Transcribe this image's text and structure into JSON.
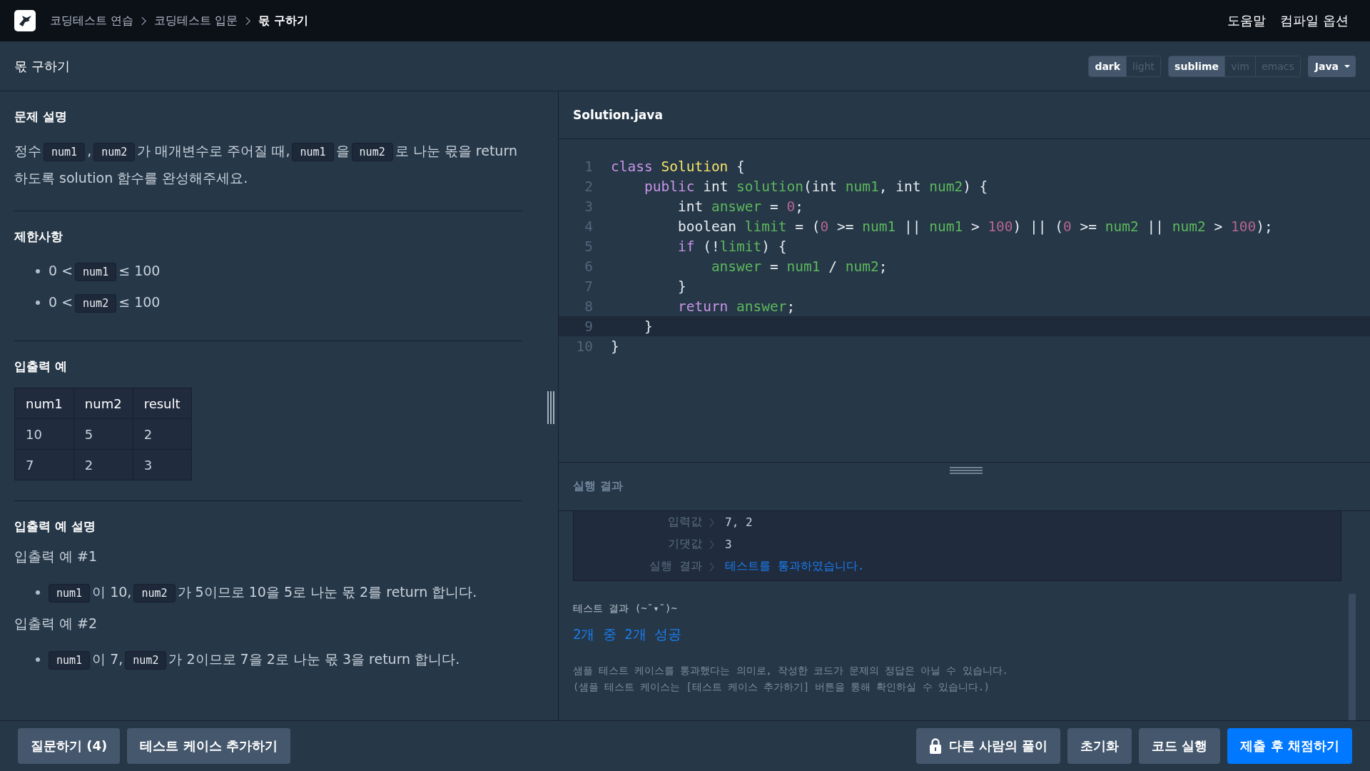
{
  "nav": {
    "breadcrumbs": [
      {
        "label": "코딩테스트 연습",
        "current": false
      },
      {
        "label": "코딩테스트 입문",
        "current": false
      },
      {
        "label": "몫 구하기",
        "current": true
      }
    ],
    "links": [
      "도움말",
      "컴파일 옵션"
    ]
  },
  "title_bar": {
    "title": "몫 구하기",
    "theme_options": [
      {
        "label": "dark",
        "selected": true
      },
      {
        "label": "light",
        "selected": false
      }
    ],
    "keymap_options": [
      {
        "label": "sublime",
        "selected": true
      },
      {
        "label": "vim",
        "selected": false
      },
      {
        "label": "emacs",
        "selected": false
      }
    ],
    "language": "Java"
  },
  "problem": {
    "sections": [
      {
        "kind": "paragraph",
        "heading": "문제 설명",
        "segments": [
          {
            "kind": "text",
            "text": "정수"
          },
          {
            "kind": "code",
            "text": "num1"
          },
          {
            "kind": "text",
            "text": ","
          },
          {
            "kind": "code",
            "text": "num2"
          },
          {
            "kind": "text",
            "text": "가 매개변수로 주어질 때,"
          },
          {
            "kind": "code",
            "text": "num1"
          },
          {
            "kind": "text",
            "text": "을"
          },
          {
            "kind": "code",
            "text": "num2"
          },
          {
            "kind": "text",
            "text": "로 나눈 몫을 return 하도록 solution 함수를 완성해주세요."
          }
        ]
      },
      {
        "kind": "bullets",
        "heading": "제한사항",
        "items": [
          {
            "segments": [
              {
                "kind": "text",
                "text": "0 <"
              },
              {
                "kind": "code",
                "text": "num1"
              },
              {
                "kind": "text",
                "text": "≤ 100"
              }
            ]
          },
          {
            "segments": [
              {
                "kind": "text",
                "text": "0 <"
              },
              {
                "kind": "code",
                "text": "num2"
              },
              {
                "kind": "text",
                "text": "≤ 100"
              }
            ]
          }
        ]
      },
      {
        "kind": "table",
        "heading": "입출력 예",
        "columns": [
          "num1",
          "num2",
          "result"
        ],
        "rows": [
          [
            "10",
            "5",
            "2"
          ],
          [
            "7",
            "2",
            "3"
          ]
        ]
      },
      {
        "kind": "examples",
        "heading": "입출력 예 설명",
        "examples": [
          {
            "title": "입출력 예 #1",
            "items": [
              {
                "segments": [
                  {
                    "kind": "code",
                    "text": "num1"
                  },
                  {
                    "kind": "text",
                    "text": "이 10,"
                  },
                  {
                    "kind": "code",
                    "text": "num2"
                  },
                  {
                    "kind": "text",
                    "text": "가 5이므로 10을 5로 나눈 몫 2를 return 합니다."
                  }
                ]
              }
            ]
          },
          {
            "title": "입출력 예 #2",
            "items": [
              {
                "segments": [
                  {
                    "kind": "code",
                    "text": "num1"
                  },
                  {
                    "kind": "text",
                    "text": "이 7,"
                  },
                  {
                    "kind": "code",
                    "text": "num2"
                  },
                  {
                    "kind": "text",
                    "text": "가 2이므로 7을 2로 나눈 몫 3을 return 합니다."
                  }
                ]
              }
            ]
          }
        ]
      }
    ]
  },
  "editor": {
    "filename": "Solution.java",
    "lines": [
      {
        "number": "1",
        "active": false,
        "tokens": [
          {
            "kind": "keyword",
            "text": "class"
          },
          {
            "kind": "class",
            "text": " Solution"
          },
          {
            "kind": "plain",
            "text": " {"
          }
        ]
      },
      {
        "number": "2",
        "active": false,
        "tokens": [
          {
            "kind": "keyword",
            "text": "    public"
          },
          {
            "kind": "plain",
            "text": " int "
          },
          {
            "kind": "name",
            "text": "solution"
          },
          {
            "kind": "plain",
            "text": "(int "
          },
          {
            "kind": "name",
            "text": "num1"
          },
          {
            "kind": "plain",
            "text": ", int "
          },
          {
            "kind": "name",
            "text": "num2"
          },
          {
            "kind": "plain",
            "text": ") {"
          }
        ]
      },
      {
        "number": "3",
        "active": false,
        "tokens": [
          {
            "kind": "plain",
            "text": "        int "
          },
          {
            "kind": "name",
            "text": "answer"
          },
          {
            "kind": "plain",
            "text": " = "
          },
          {
            "kind": "number",
            "text": "0"
          },
          {
            "kind": "plain",
            "text": ";"
          }
        ]
      },
      {
        "number": "4",
        "active": false,
        "tokens": [
          {
            "kind": "plain",
            "text": "        boolean "
          },
          {
            "kind": "name",
            "text": "limit"
          },
          {
            "kind": "plain",
            "text": " = ("
          },
          {
            "kind": "number",
            "text": "0"
          },
          {
            "kind": "plain",
            "text": " >= "
          },
          {
            "kind": "name",
            "text": "num1"
          },
          {
            "kind": "plain",
            "text": " || "
          },
          {
            "kind": "name",
            "text": "num1"
          },
          {
            "kind": "plain",
            "text": " > "
          },
          {
            "kind": "number",
            "text": "100"
          },
          {
            "kind": "plain",
            "text": ") || ("
          },
          {
            "kind": "number",
            "text": "0"
          },
          {
            "kind": "plain",
            "text": " >= "
          },
          {
            "kind": "name",
            "text": "num2"
          },
          {
            "kind": "plain",
            "text": " || "
          },
          {
            "kind": "name",
            "text": "num2"
          },
          {
            "kind": "plain",
            "text": " > "
          },
          {
            "kind": "number",
            "text": "100"
          },
          {
            "kind": "plain",
            "text": ");"
          }
        ]
      },
      {
        "number": "5",
        "active": false,
        "tokens": [
          {
            "kind": "keyword",
            "text": "        if"
          },
          {
            "kind": "plain",
            "text": " (!"
          },
          {
            "kind": "name",
            "text": "limit"
          },
          {
            "kind": "plain",
            "text": ") {"
          }
        ]
      },
      {
        "number": "6",
        "active": false,
        "tokens": [
          {
            "kind": "name",
            "text": "            answer"
          },
          {
            "kind": "plain",
            "text": " = "
          },
          {
            "kind": "name",
            "text": "num1"
          },
          {
            "kind": "plain",
            "text": " / "
          },
          {
            "kind": "name",
            "text": "num2"
          },
          {
            "kind": "plain",
            "text": ";"
          }
        ]
      },
      {
        "number": "7",
        "active": false,
        "tokens": [
          {
            "kind": "plain",
            "text": "        }"
          }
        ]
      },
      {
        "number": "8",
        "active": false,
        "tokens": [
          {
            "kind": "keyword",
            "text": "        return"
          },
          {
            "kind": "name",
            "text": " answer"
          },
          {
            "kind": "plain",
            "text": ";"
          }
        ]
      },
      {
        "number": "9",
        "active": true,
        "tokens": [
          {
            "kind": "plain",
            "text": "    }"
          }
        ]
      },
      {
        "number": "10",
        "active": false,
        "tokens": [
          {
            "kind": "plain",
            "text": "}"
          }
        ]
      }
    ]
  },
  "results": {
    "heading": "실행 결과",
    "case_rows": [
      {
        "label": "입력값",
        "value": "7, 2",
        "kind": "plain"
      },
      {
        "label": "기댓값",
        "value": "3",
        "kind": "plain"
      },
      {
        "label": "실행 결과",
        "value": "테스트를 통과하였습니다.",
        "kind": "success"
      }
    ],
    "summary_title": "테스트 결과 (~˘▾˘)~",
    "summary": "2개 중 2개 성공",
    "notes": [
      "샘플 테스트 케이스를 통과했다는 의미로, 작성한 코드가 문제의 정답은 아닐 수 있습니다.",
      "(샘플 테스트 케이스는 [테스트 케이스 추가하기] 버튼을 통해 확인하실 수 있습니다.)"
    ]
  },
  "bottom_bar": {
    "left_buttons": [
      {
        "label": "질문하기 (4)",
        "kind": "secondary"
      },
      {
        "label": "테스트 케이스 추가하기",
        "kind": "secondary"
      }
    ],
    "right_buttons": [
      {
        "label": "다른 사람의 풀이",
        "kind": "locked"
      },
      {
        "label": "초기화",
        "kind": "secondary"
      },
      {
        "label": "코드 실행",
        "kind": "secondary"
      },
      {
        "label": "제출 후 채점하기",
        "kind": "primary"
      }
    ]
  }
}
